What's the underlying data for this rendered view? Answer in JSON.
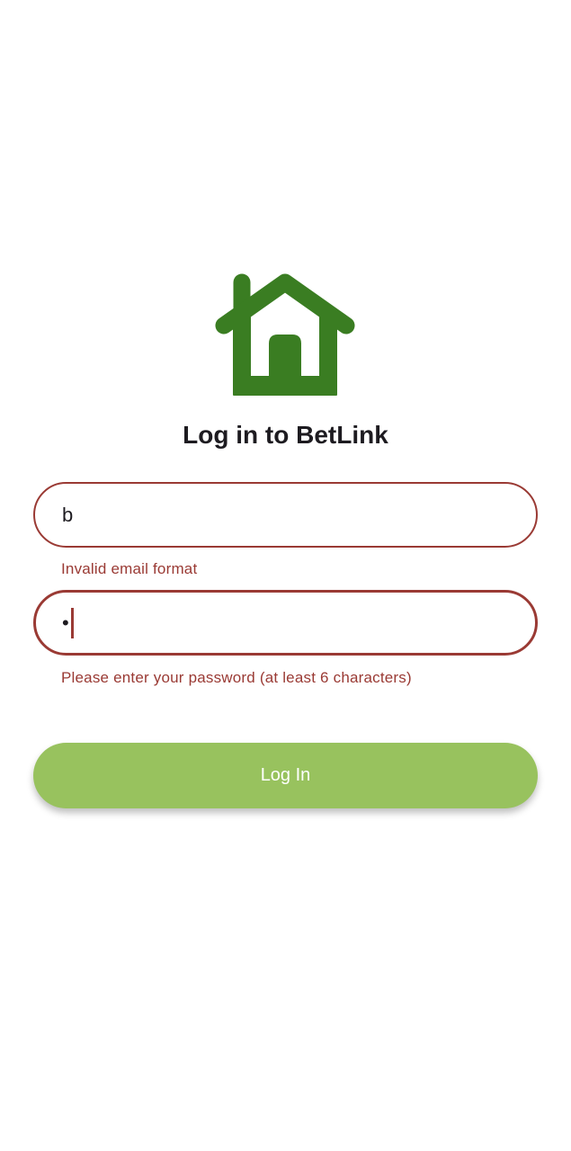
{
  "app": {
    "title": "Log in to BetLink",
    "logo_icon": "home-icon",
    "brand_color": "#3a7d22"
  },
  "form": {
    "email": {
      "value": "b",
      "error": "Invalid email format"
    },
    "password": {
      "value": "•",
      "error": "Please enter your password (at least 6 characters)"
    },
    "submit_label": "Log In",
    "error_color": "#9a3a34",
    "button_color": "#98c25e"
  }
}
